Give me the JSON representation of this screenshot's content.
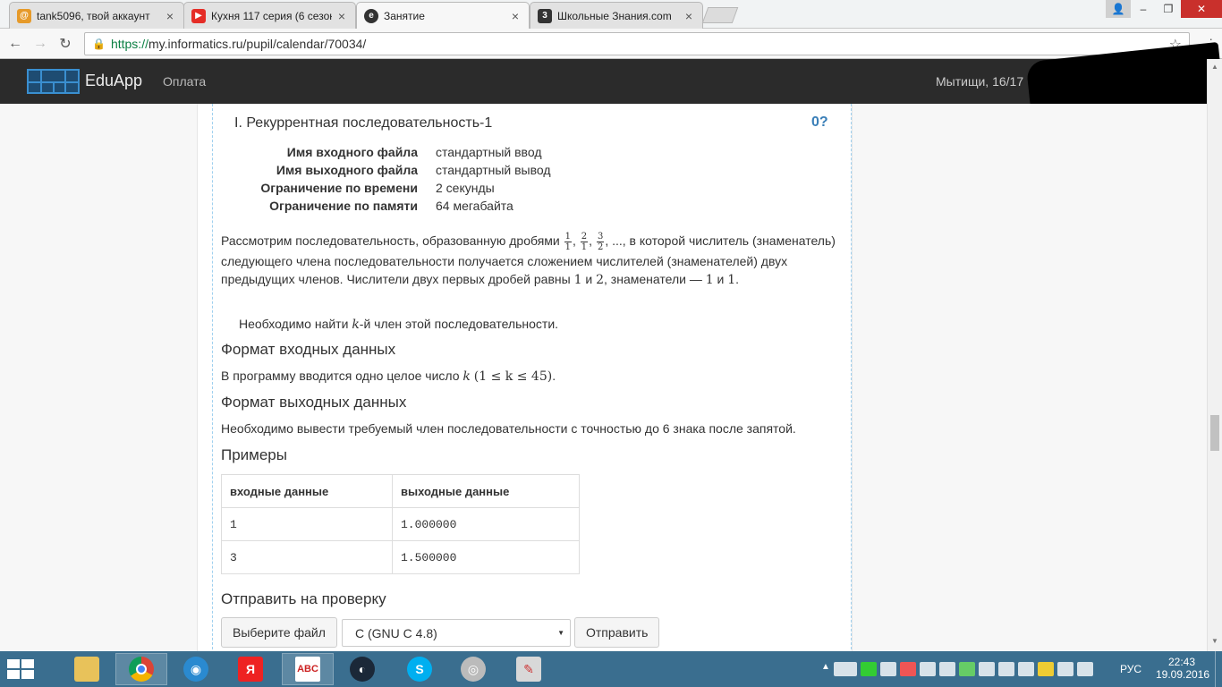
{
  "browser": {
    "tabs": [
      {
        "title": "tank5096, твой аккаунт",
        "icon": "globe-icon",
        "color": "#e69a2a"
      },
      {
        "title": "Кухня 117 серия (6 сезон",
        "icon": "youtube-icon",
        "color": "#e52d27"
      },
      {
        "title": "Занятие",
        "icon": "site-icon",
        "color": "#333333"
      },
      {
        "title": "Школьные Знания.com",
        "icon": "znanija-icon",
        "color": "#333333"
      }
    ],
    "url_https": "https://",
    "url_rest": "my.informatics.ru/pupil/calendar/70034/"
  },
  "header": {
    "brand": "EduApp",
    "nav_pay": "Оплата",
    "school": "Мытищи, 16/17"
  },
  "problem": {
    "title": "I. Рекуррентная последовательность-1",
    "score": "0",
    "score_help": "?",
    "limits": [
      {
        "key": "Имя входного файла",
        "value": "стандартный ввод"
      },
      {
        "key": "Имя выходного файла",
        "value": "стандартный вывод"
      },
      {
        "key": "Ограничение по времени",
        "value": "2 секунды"
      },
      {
        "key": "Ограничение по памяти",
        "value": "64 мегабайта"
      }
    ],
    "statement_p1": "Рассмотрим последовательность, образованную дробями",
    "statement_p1b": ", ..., в которой числитель (знаменатель) следующего члена последовательности получается сложением числителей (знаменателей) двух предыдущих членов. Числители двух первых дробей равны",
    "statement_and": "и",
    "statement_denoms": ", знаменатели —",
    "statement_p2_pre": "Необходимо найти",
    "statement_p2_post": "-й член этой последовательности.",
    "fractions": [
      {
        "num": "1",
        "den": "1"
      },
      {
        "num": "2",
        "den": "1"
      },
      {
        "num": "3",
        "den": "2"
      }
    ],
    "input_format_h": "Формат входных данных",
    "input_format_pre": "В программу вводится одно целое число",
    "input_format_math": "(1 ≤ k ≤ 45)",
    "output_format_h": "Формат выходных данных",
    "output_format": "Необходимо вывести требуемый член последовательности с точностью до 6 знака после запятой.",
    "examples_h": "Примеры",
    "examples_head": [
      "входные данные",
      "выходные данные"
    ],
    "examples_rows": [
      [
        "1",
        "1.000000"
      ],
      [
        "3",
        "1.500000"
      ]
    ],
    "submit_h": "Отправить на проверку",
    "choose_file": "Выберите файл",
    "compiler": "C (GNU C 4.8)",
    "send": "Отправить"
  },
  "taskbar": {
    "lang": "РУС",
    "time": "22:43",
    "date": "19.09.2016"
  }
}
